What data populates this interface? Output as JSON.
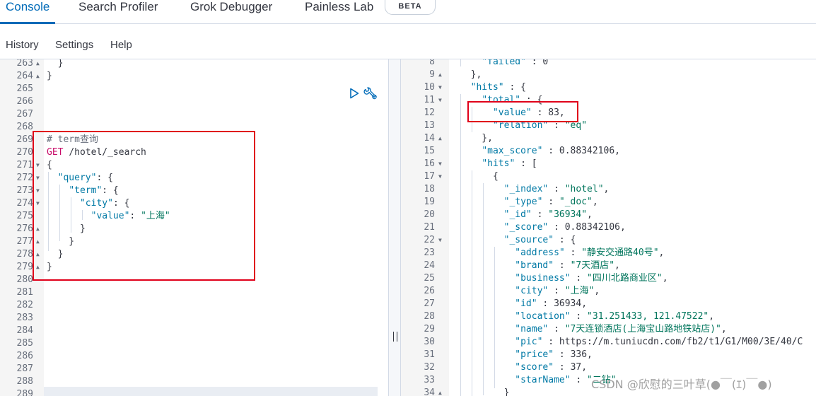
{
  "tabs": [
    {
      "label": "Console",
      "active": true
    },
    {
      "label": "Search Profiler",
      "active": false
    },
    {
      "label": "Grok Debugger",
      "active": false
    },
    {
      "label": "Painless Lab",
      "active": false
    }
  ],
  "beta_badge": "BETA",
  "menu": [
    "History",
    "Settings",
    "Help"
  ],
  "left_editor": {
    "lines": [
      {
        "n": "263",
        "fold": "▲",
        "code": "  }"
      },
      {
        "n": "264",
        "fold": "▲",
        "code": "}"
      },
      {
        "n": "265",
        "fold": "",
        "code": ""
      },
      {
        "n": "266",
        "fold": "",
        "code": ""
      },
      {
        "n": "267",
        "fold": "",
        "code": ""
      },
      {
        "n": "268",
        "fold": "",
        "code": ""
      },
      {
        "n": "269",
        "fold": "",
        "code": "# term查询"
      },
      {
        "n": "270",
        "fold": "",
        "code": "GET /hotel/_search"
      },
      {
        "n": "271",
        "fold": "▼",
        "code": "{"
      },
      {
        "n": "272",
        "fold": "▼",
        "code": "  \"query\": {"
      },
      {
        "n": "273",
        "fold": "▼",
        "code": "    \"term\": {"
      },
      {
        "n": "274",
        "fold": "▼",
        "code": "      \"city\": {"
      },
      {
        "n": "275",
        "fold": "",
        "code": "        \"value\": \"上海\""
      },
      {
        "n": "276",
        "fold": "▲",
        "code": "      }"
      },
      {
        "n": "277",
        "fold": "▲",
        "code": "    }"
      },
      {
        "n": "278",
        "fold": "▲",
        "code": "  }"
      },
      {
        "n": "279",
        "fold": "▲",
        "code": "}"
      },
      {
        "n": "280",
        "fold": "",
        "code": ""
      },
      {
        "n": "281",
        "fold": "",
        "code": ""
      },
      {
        "n": "282",
        "fold": "",
        "code": ""
      },
      {
        "n": "283",
        "fold": "",
        "code": ""
      },
      {
        "n": "284",
        "fold": "",
        "code": ""
      },
      {
        "n": "285",
        "fold": "",
        "code": ""
      },
      {
        "n": "286",
        "fold": "",
        "code": ""
      },
      {
        "n": "287",
        "fold": "",
        "code": ""
      },
      {
        "n": "288",
        "fold": "",
        "code": ""
      },
      {
        "n": "289",
        "fold": "",
        "code": ""
      }
    ]
  },
  "right_editor": {
    "lines": [
      {
        "n": "8",
        "fold": "",
        "code": "    \"failed\" : 0"
      },
      {
        "n": "9",
        "fold": "▲",
        "code": "  },"
      },
      {
        "n": "10",
        "fold": "▼",
        "code": "  \"hits\" : {"
      },
      {
        "n": "11",
        "fold": "▼",
        "code": "    \"total\" : {"
      },
      {
        "n": "12",
        "fold": "",
        "code": "      \"value\" : 83,"
      },
      {
        "n": "13",
        "fold": "",
        "code": "      \"relation\" : \"eq\""
      },
      {
        "n": "14",
        "fold": "▲",
        "code": "    },"
      },
      {
        "n": "15",
        "fold": "",
        "code": "    \"max_score\" : 0.88342106,"
      },
      {
        "n": "16",
        "fold": "▼",
        "code": "    \"hits\" : ["
      },
      {
        "n": "17",
        "fold": "▼",
        "code": "      {"
      },
      {
        "n": "18",
        "fold": "",
        "code": "        \"_index\" : \"hotel\","
      },
      {
        "n": "19",
        "fold": "",
        "code": "        \"_type\" : \"_doc\","
      },
      {
        "n": "20",
        "fold": "",
        "code": "        \"_id\" : \"36934\","
      },
      {
        "n": "21",
        "fold": "",
        "code": "        \"_score\" : 0.88342106,"
      },
      {
        "n": "22",
        "fold": "▼",
        "code": "        \"_source\" : {"
      },
      {
        "n": "23",
        "fold": "",
        "code": "          \"address\" : \"静安交通路40号\","
      },
      {
        "n": "24",
        "fold": "",
        "code": "          \"brand\" : \"7天酒店\","
      },
      {
        "n": "25",
        "fold": "",
        "code": "          \"business\" : \"四川北路商业区\","
      },
      {
        "n": "26",
        "fold": "",
        "code": "          \"city\" : \"上海\","
      },
      {
        "n": "27",
        "fold": "",
        "code": "          \"id\" : 36934,"
      },
      {
        "n": "28",
        "fold": "",
        "code": "          \"location\" : \"31.251433, 121.47522\","
      },
      {
        "n": "29",
        "fold": "",
        "code": "          \"name\" : \"7天连锁酒店(上海宝山路地铁站店)\","
      },
      {
        "n": "30",
        "fold": "",
        "code": "          \"pic\" : \"https://m.tuniucdn.com/fb2/t1/G1/M00/3E/40/C"
      },
      {
        "n": "31",
        "fold": "",
        "code": "          \"price\" : 336,"
      },
      {
        "n": "32",
        "fold": "",
        "code": "          \"score\" : 37,"
      },
      {
        "n": "33",
        "fold": "",
        "code": "          \"starName\" : \"二钻\""
      },
      {
        "n": "34",
        "fold": "▲",
        "code": "        }"
      }
    ]
  },
  "watermark": "CSDN @欣慰的三叶草(●￣(ｴ)￣●)",
  "colors": {
    "accent": "#006bb8",
    "annotation": "#e0001a",
    "method": "#c80a68",
    "string": "#00755c",
    "key": "#0079a5"
  }
}
